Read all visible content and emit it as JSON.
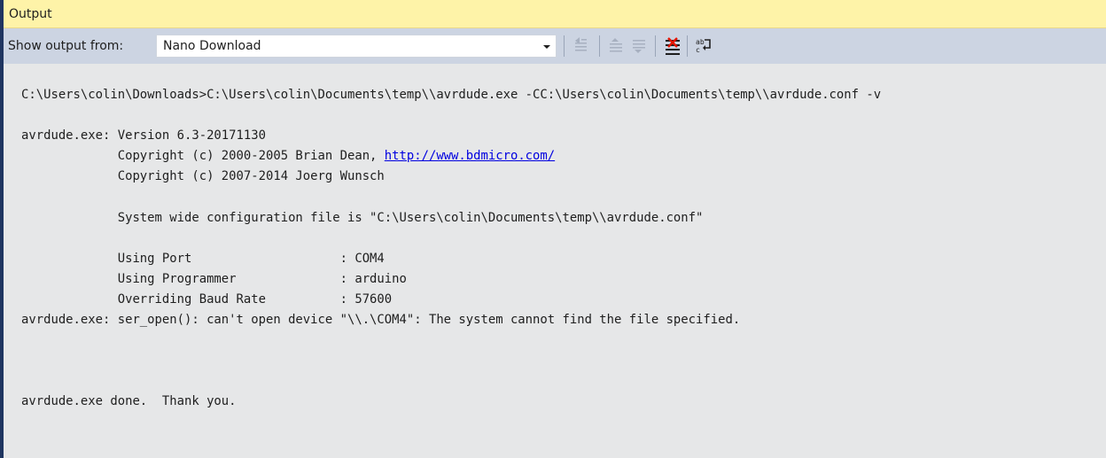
{
  "window": {
    "title": "Output"
  },
  "toolbar": {
    "show_output_label": "Show output from:",
    "source_selected": "Nano Download",
    "buttons": [
      {
        "icon": "find-message-in-code-icon",
        "enabled": false
      },
      {
        "icon": "go-to-previous-message-icon",
        "enabled": false
      },
      {
        "icon": "go-to-next-message-icon",
        "enabled": false
      },
      {
        "icon": "clear-all-icon",
        "enabled": true
      },
      {
        "icon": "toggle-word-wrap-icon",
        "enabled": true
      }
    ]
  },
  "output": {
    "line1": "C:\\Users\\colin\\Downloads>C:\\Users\\colin\\Documents\\temp\\\\avrdude.exe -CC:\\Users\\colin\\Documents\\temp\\\\avrdude.conf -v",
    "line2": "avrdude.exe: Version 6.3-20171130",
    "line3_prefix": "             Copyright (c) 2000-2005 Brian Dean, ",
    "line3_link": "http://www.bdmicro.com/",
    "line4": "             Copyright (c) 2007-2014 Joerg Wunsch",
    "line5": "             System wide configuration file is \"C:\\Users\\colin\\Documents\\temp\\\\avrdude.conf\"",
    "line6": "             Using Port                    : COM4",
    "line7": "             Using Programmer              : arduino",
    "line8": "             Overriding Baud Rate          : 57600",
    "line9": "avrdude.exe: ser_open(): can't open device \"\\\\.\\COM4\": The system cannot find the file specified.",
    "line10": "avrdude.exe done.  Thank you."
  },
  "colors": {
    "title_bar": "#fef3a8",
    "toolbar": "#ccd4e2",
    "content_bg": "#e6e7e8",
    "link": "#0000e0"
  }
}
